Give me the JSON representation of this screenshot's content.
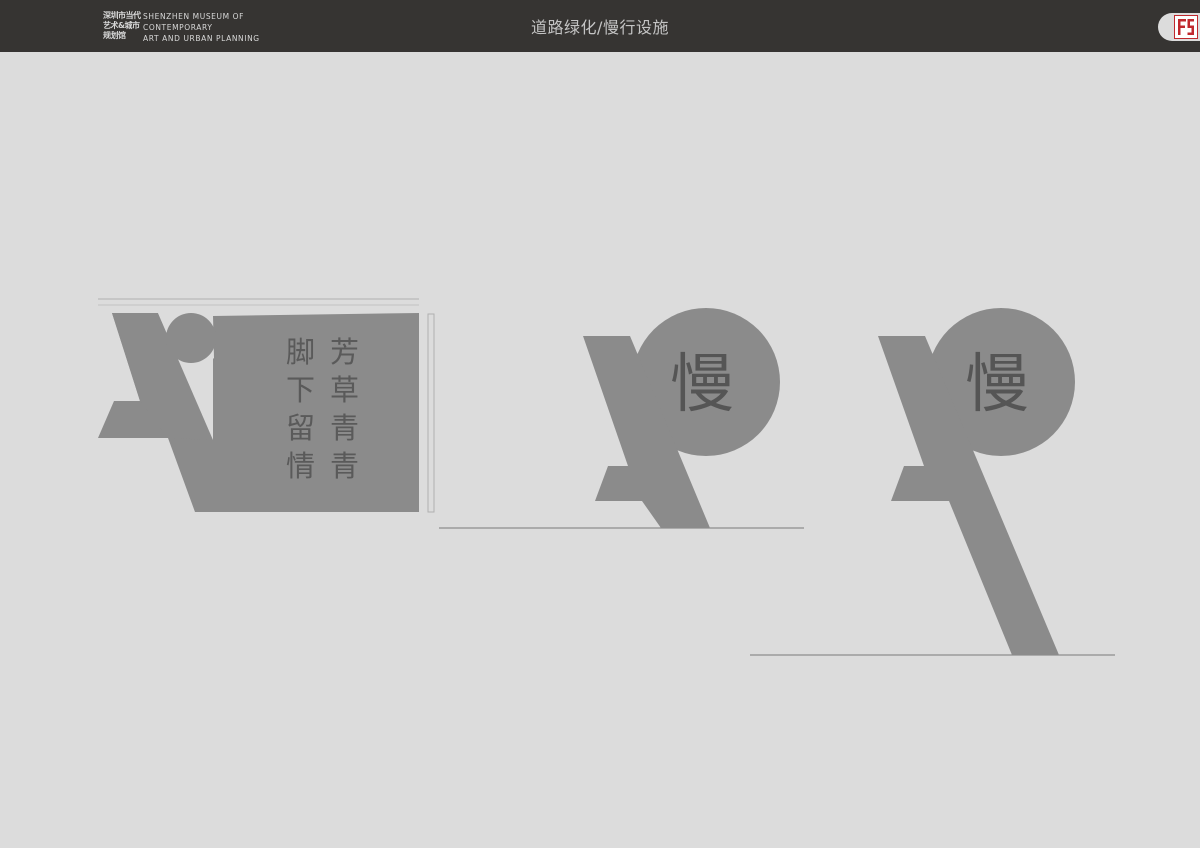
{
  "header": {
    "logo_cn_lines": [
      "深圳市当代",
      "艺术&城市",
      "规划馆"
    ],
    "logo_en_lines": [
      "SHENZHEN MUSEUM OF",
      "CONTEMPORARY",
      "ART AND URBAN PLANNING"
    ],
    "title": "道路绿化/慢行设施",
    "brand_mark_icon": "fs-monogram-icon"
  },
  "signs": {
    "wall_sign": {
      "col1": [
        "脚",
        "下",
        "留",
        "情"
      ],
      "col2": [
        "芳",
        "草",
        "青",
        "青"
      ]
    },
    "short_post": {
      "glyph": "慢"
    },
    "tall_post": {
      "glyph": "慢"
    }
  },
  "colors": {
    "topbar": "#363432",
    "background": "#dcdcdc",
    "sign_fill": "#8b8b8b",
    "sign_text": "#555555",
    "brand_red": "#c0282d"
  }
}
